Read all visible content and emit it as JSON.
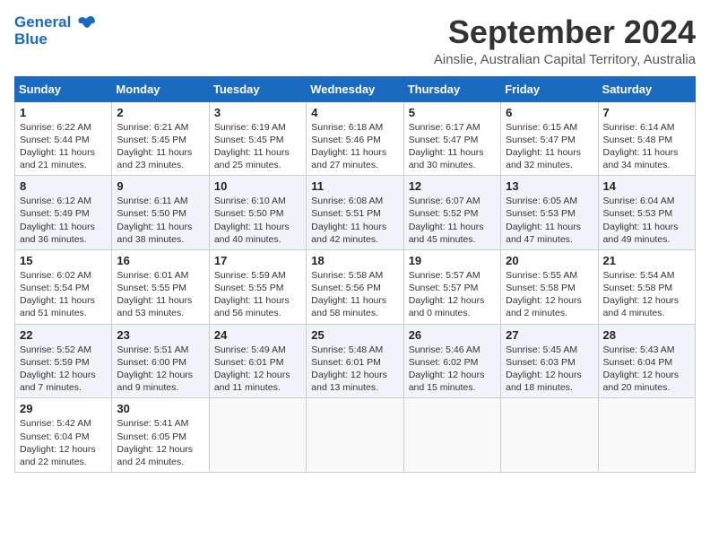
{
  "header": {
    "logo_line1": "General",
    "logo_line2": "Blue",
    "month_title": "September 2024",
    "location": "Ainslie, Australian Capital Territory, Australia"
  },
  "calendar": {
    "days_of_week": [
      "Sunday",
      "Monday",
      "Tuesday",
      "Wednesday",
      "Thursday",
      "Friday",
      "Saturday"
    ],
    "weeks": [
      [
        {
          "day": "1",
          "info": "Sunrise: 6:22 AM\nSunset: 5:44 PM\nDaylight: 11 hours\nand 21 minutes."
        },
        {
          "day": "2",
          "info": "Sunrise: 6:21 AM\nSunset: 5:45 PM\nDaylight: 11 hours\nand 23 minutes."
        },
        {
          "day": "3",
          "info": "Sunrise: 6:19 AM\nSunset: 5:45 PM\nDaylight: 11 hours\nand 25 minutes."
        },
        {
          "day": "4",
          "info": "Sunrise: 6:18 AM\nSunset: 5:46 PM\nDaylight: 11 hours\nand 27 minutes."
        },
        {
          "day": "5",
          "info": "Sunrise: 6:17 AM\nSunset: 5:47 PM\nDaylight: 11 hours\nand 30 minutes."
        },
        {
          "day": "6",
          "info": "Sunrise: 6:15 AM\nSunset: 5:47 PM\nDaylight: 11 hours\nand 32 minutes."
        },
        {
          "day": "7",
          "info": "Sunrise: 6:14 AM\nSunset: 5:48 PM\nDaylight: 11 hours\nand 34 minutes."
        }
      ],
      [
        {
          "day": "8",
          "info": "Sunrise: 6:12 AM\nSunset: 5:49 PM\nDaylight: 11 hours\nand 36 minutes."
        },
        {
          "day": "9",
          "info": "Sunrise: 6:11 AM\nSunset: 5:50 PM\nDaylight: 11 hours\nand 38 minutes."
        },
        {
          "day": "10",
          "info": "Sunrise: 6:10 AM\nSunset: 5:50 PM\nDaylight: 11 hours\nand 40 minutes."
        },
        {
          "day": "11",
          "info": "Sunrise: 6:08 AM\nSunset: 5:51 PM\nDaylight: 11 hours\nand 42 minutes."
        },
        {
          "day": "12",
          "info": "Sunrise: 6:07 AM\nSunset: 5:52 PM\nDaylight: 11 hours\nand 45 minutes."
        },
        {
          "day": "13",
          "info": "Sunrise: 6:05 AM\nSunset: 5:53 PM\nDaylight: 11 hours\nand 47 minutes."
        },
        {
          "day": "14",
          "info": "Sunrise: 6:04 AM\nSunset: 5:53 PM\nDaylight: 11 hours\nand 49 minutes."
        }
      ],
      [
        {
          "day": "15",
          "info": "Sunrise: 6:02 AM\nSunset: 5:54 PM\nDaylight: 11 hours\nand 51 minutes."
        },
        {
          "day": "16",
          "info": "Sunrise: 6:01 AM\nSunset: 5:55 PM\nDaylight: 11 hours\nand 53 minutes."
        },
        {
          "day": "17",
          "info": "Sunrise: 5:59 AM\nSunset: 5:55 PM\nDaylight: 11 hours\nand 56 minutes."
        },
        {
          "day": "18",
          "info": "Sunrise: 5:58 AM\nSunset: 5:56 PM\nDaylight: 11 hours\nand 58 minutes."
        },
        {
          "day": "19",
          "info": "Sunrise: 5:57 AM\nSunset: 5:57 PM\nDaylight: 12 hours\nand 0 minutes."
        },
        {
          "day": "20",
          "info": "Sunrise: 5:55 AM\nSunset: 5:58 PM\nDaylight: 12 hours\nand 2 minutes."
        },
        {
          "day": "21",
          "info": "Sunrise: 5:54 AM\nSunset: 5:58 PM\nDaylight: 12 hours\nand 4 minutes."
        }
      ],
      [
        {
          "day": "22",
          "info": "Sunrise: 5:52 AM\nSunset: 5:59 PM\nDaylight: 12 hours\nand 7 minutes."
        },
        {
          "day": "23",
          "info": "Sunrise: 5:51 AM\nSunset: 6:00 PM\nDaylight: 12 hours\nand 9 minutes."
        },
        {
          "day": "24",
          "info": "Sunrise: 5:49 AM\nSunset: 6:01 PM\nDaylight: 12 hours\nand 11 minutes."
        },
        {
          "day": "25",
          "info": "Sunrise: 5:48 AM\nSunset: 6:01 PM\nDaylight: 12 hours\nand 13 minutes."
        },
        {
          "day": "26",
          "info": "Sunrise: 5:46 AM\nSunset: 6:02 PM\nDaylight: 12 hours\nand 15 minutes."
        },
        {
          "day": "27",
          "info": "Sunrise: 5:45 AM\nSunset: 6:03 PM\nDaylight: 12 hours\nand 18 minutes."
        },
        {
          "day": "28",
          "info": "Sunrise: 5:43 AM\nSunset: 6:04 PM\nDaylight: 12 hours\nand 20 minutes."
        }
      ],
      [
        {
          "day": "29",
          "info": "Sunrise: 5:42 AM\nSunset: 6:04 PM\nDaylight: 12 hours\nand 22 minutes."
        },
        {
          "day": "30",
          "info": "Sunrise: 5:41 AM\nSunset: 6:05 PM\nDaylight: 12 hours\nand 24 minutes."
        },
        {
          "day": "",
          "info": ""
        },
        {
          "day": "",
          "info": ""
        },
        {
          "day": "",
          "info": ""
        },
        {
          "day": "",
          "info": ""
        },
        {
          "day": "",
          "info": ""
        }
      ]
    ]
  }
}
